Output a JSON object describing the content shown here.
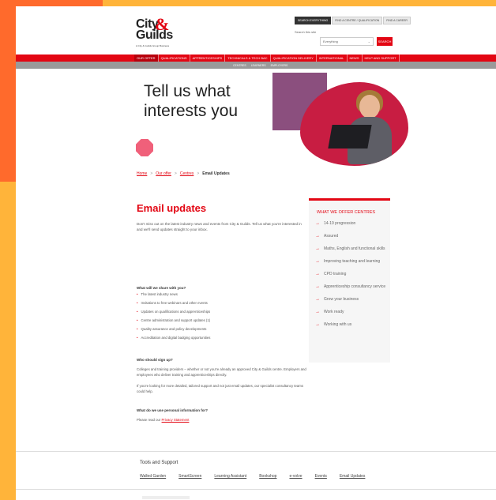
{
  "brand": {
    "logo_city": "City",
    "logo_amp": "&",
    "logo_guilds": "Guilds",
    "logo_tagline": "A City & Guilds Group Business",
    "accent": "#e30613"
  },
  "search": {
    "tabs": [
      "SEARCH EVERYTHING",
      "FIND A CENTRE / QUALIFICATION",
      "FIND A CAREER"
    ],
    "label": "Search this site",
    "select_value": "Everything",
    "button": "SEARCH"
  },
  "nav": {
    "items": [
      "OUR OFFER",
      "QUALIFICATIONS",
      "APPRENTICESHIPS",
      "TECHNICALS & TECH BAC",
      "QUALIFICATION DELIVERY",
      "INTERNATIONAL",
      "NEWS",
      "HELP AND SUPPORT"
    ],
    "subitems": [
      "CENTRES",
      "LEARNERS",
      "EMPLOYERS"
    ]
  },
  "hero": {
    "title_line1": "Tell us what",
    "title_line2": "interests you"
  },
  "breadcrumb": {
    "items": [
      "Home",
      "Our offer",
      "Centres"
    ],
    "separator": ">",
    "current": "Email Updates"
  },
  "main": {
    "title": "Email updates",
    "intro": "Don't miss out on the latest industry news and events from City & Guilds. Tell us what you're interested in and we'll send updates straight to your inbox.",
    "q1": "What will we share with you?",
    "bullets": [
      "The latest industry news",
      "Invitations to free webinars and other events",
      "Updates on qualifications and apprenticeships",
      "Centre administration and support updates (1)",
      "Quality assurance and policy developments",
      "Accreditation and digital badging opportunities"
    ],
    "q2": "Who should sign up?",
    "p1": "Colleges and training providers – whether or not you're already an approved City & Guilds centre. Employers and employees who deliver training and apprenticeships directly.",
    "p2": "If you're looking for more detailed, tailored support and not just email updates, our specialist consultancy teams could help.",
    "q3": "What do we use personal information for?",
    "p3_prefix": "Please read our",
    "p3_link": "Privacy Statement"
  },
  "sidebar": {
    "title": "WHAT WE OFFER CENTRES",
    "items": [
      "14-19 progression",
      "Assured",
      "Maths, English and functional skills",
      "Improving teaching and learning",
      "CPD training",
      "Apprenticeship consultancy service",
      "Grow your business",
      "Work ready",
      "Working with us"
    ]
  },
  "footer": {
    "title": "Tools and Support",
    "links": [
      "Walled Garden",
      "SmartScreen",
      "Learning Assistant",
      "Bookshop",
      "e-volve",
      "Events",
      "Email Updates"
    ]
  }
}
